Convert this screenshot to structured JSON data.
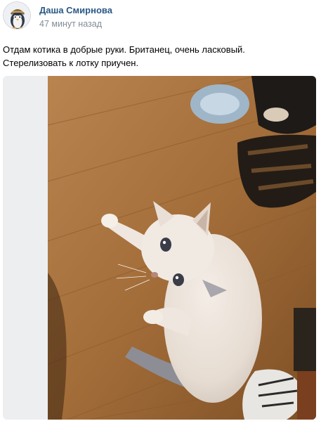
{
  "post": {
    "author": "Даша Смирнова",
    "time": "47 минут назад",
    "text_lines": [
      "Отдам котика в добрые руки. Британец, очень ласковый.",
      "Стерелизовать к лотку приучен."
    ]
  },
  "avatar": {
    "icon": "penguin-avatar-icon"
  },
  "photo": {
    "subject": "cat-photo-icon"
  },
  "colors": {
    "author": "#2a5885",
    "time": "#818c99",
    "text": "#000000",
    "media_bg": "#edeef0",
    "floor": "#a9743f"
  }
}
